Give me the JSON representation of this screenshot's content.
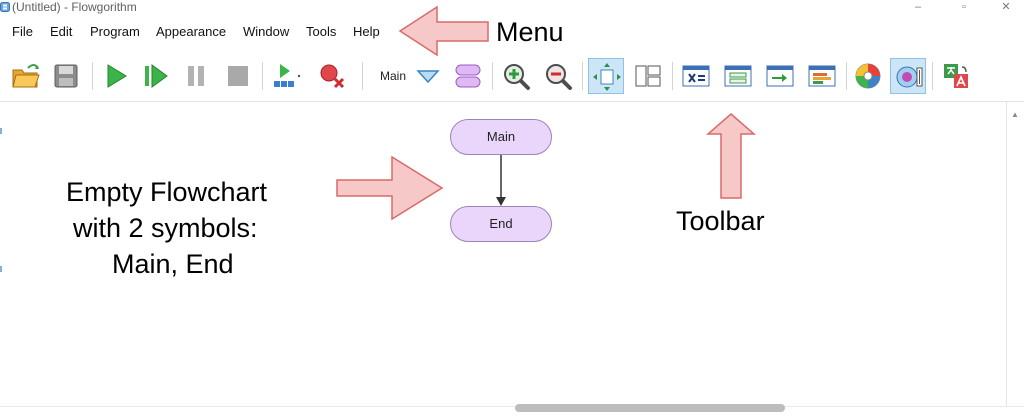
{
  "window": {
    "title": "(Untitled) - Flowgorithm",
    "app_icon": "flowgorithm-app-icon",
    "minimize_glyph": "–",
    "maximize_glyph": "▫",
    "close_glyph": "✕"
  },
  "menu": {
    "items": [
      "File",
      "Edit",
      "Program",
      "Appearance",
      "Window",
      "Tools",
      "Help"
    ]
  },
  "toolbar": {
    "function_label": "Main",
    "buttons": [
      {
        "icon": "open-folder-icon"
      },
      {
        "icon": "save-icon"
      },
      {
        "icon": "run-icon"
      },
      {
        "icon": "step-icon"
      },
      {
        "icon": "pause-icon"
      },
      {
        "icon": "stop-icon"
      },
      {
        "icon": "variable-watch-icon"
      },
      {
        "icon": "breakpoint-clear-icon"
      },
      {
        "icon": "function-dropdown-icon"
      },
      {
        "icon": "function-manager-icon"
      },
      {
        "icon": "zoom-in-icon"
      },
      {
        "icon": "zoom-out-icon"
      },
      {
        "icon": "layout-icon",
        "active": true
      },
      {
        "icon": "panel-layout-icon"
      },
      {
        "icon": "variables-window-icon"
      },
      {
        "icon": "source-code-icon"
      },
      {
        "icon": "console-icon"
      },
      {
        "icon": "chart-window-icon"
      },
      {
        "icon": "color-scheme-icon"
      },
      {
        "icon": "display-options-icon",
        "active": true
      },
      {
        "icon": "translate-icon"
      }
    ]
  },
  "flowchart": {
    "nodes": [
      {
        "id": "main",
        "label": "Main",
        "shape": "terminal"
      },
      {
        "id": "end",
        "label": "End",
        "shape": "terminal"
      }
    ],
    "edges": [
      {
        "from": "main",
        "to": "end"
      }
    ],
    "node_fill": "#ead6fa",
    "node_stroke": "#9c84b8"
  },
  "annotations": {
    "menu_label": "Menu",
    "toolbar_label": "Toolbar",
    "flowchart_label_lines": [
      "Empty Flowchart",
      "with 2 symbols:",
      "Main, End"
    ],
    "arrow_fill": "#f7c8c8",
    "arrow_stroke": "#d96a6a"
  },
  "colors": {
    "toolbar_active_bg": "#cde6f7",
    "run_green": "#3bb54a",
    "stop_gray": "#a9a9a9"
  }
}
